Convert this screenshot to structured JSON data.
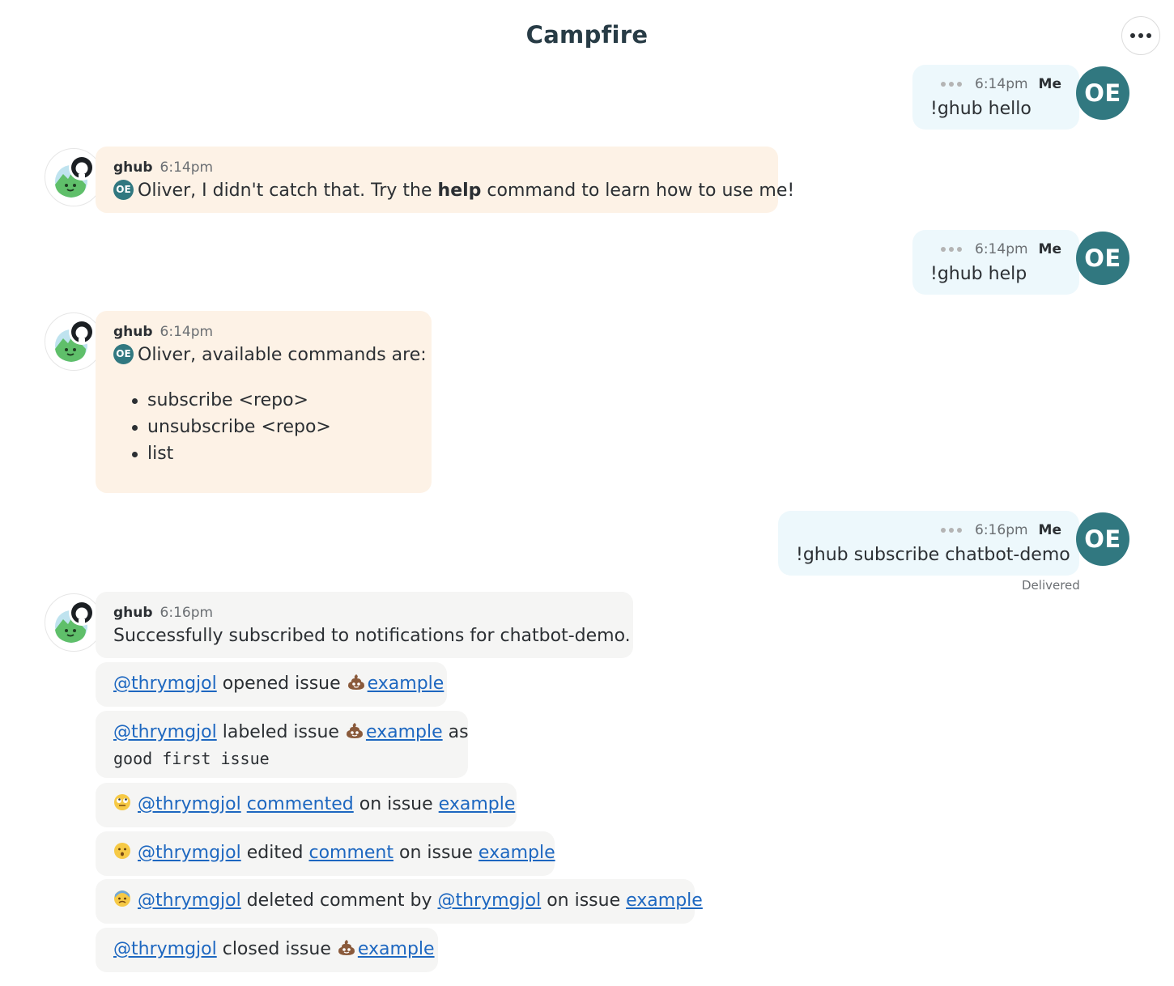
{
  "header": {
    "title": "Campfire",
    "menu_icon": "ellipsis-icon"
  },
  "outgoing": [
    {
      "time": "6:14pm",
      "sender": "Me",
      "text": "!ghub hello",
      "avatar": "OE"
    },
    {
      "time": "6:14pm",
      "sender": "Me",
      "text": "!ghub help",
      "avatar": "OE"
    },
    {
      "time": "6:16pm",
      "sender": "Me",
      "text": "!ghub subscribe chatbot-demo",
      "avatar": "OE",
      "status": "Delivered"
    }
  ],
  "bot": {
    "name": "ghub",
    "msg1": {
      "time": "6:14pm",
      "mention": "OE",
      "pre": "Oliver, I didn't catch that. Try the ",
      "bold": "help",
      "post": " command to learn how to use me!"
    },
    "msg2": {
      "time": "6:14pm",
      "mention": "OE",
      "text": "Oliver, available commands are:",
      "commands": [
        "subscribe <repo>",
        "unsubscribe <repo>",
        "list"
      ]
    },
    "msg3": {
      "time": "6:16pm",
      "text": "Successfully subscribed to notifications for chatbot-demo."
    }
  },
  "notifications": {
    "user": "@thrymgjol",
    "issue": "example",
    "opened": "opened issue",
    "labeled": "labeled issue",
    "as": "as",
    "label": "good first issue",
    "commented": "commented",
    "on_issue": "on issue",
    "edited": "edited",
    "comment": "comment",
    "deleted": "deleted comment by",
    "closed": "closed issue"
  },
  "colors": {
    "accent": "#317880",
    "link": "#1d67c0",
    "outgoing_bg": "#edf8fc",
    "bot_bg": "#fdf2e6",
    "notice_bg": "#f5f5f4"
  }
}
